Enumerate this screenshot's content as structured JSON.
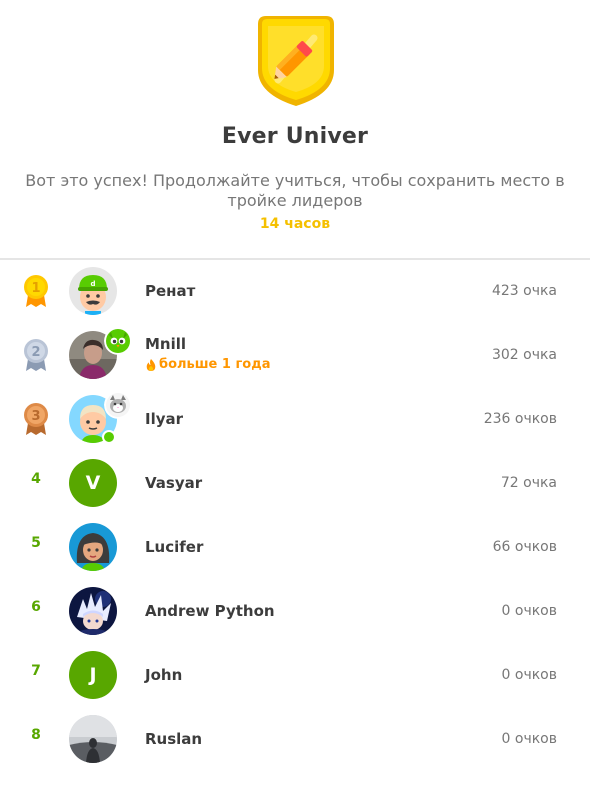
{
  "league": {
    "title": "Ever Univer",
    "subtitle": "Вот это успех! Продолжайте учиться, чтобы сохранить место в тройке лидеров",
    "time_left": "14 часов",
    "badge_icon": "pencil-shield-icon",
    "badge_color": "#ffc800"
  },
  "colors": {
    "rank_green": "#58a700",
    "gold": "#ffc800",
    "silver": "#b9c4d6",
    "bronze": "#de8a47",
    "streak_orange": "#ff9600"
  },
  "leaderboard": [
    {
      "rank": "1",
      "name": "Ренат",
      "points": "423 очка",
      "medal": "gold",
      "avatar": "cartoon-cap-avatar"
    },
    {
      "rank": "2",
      "name": "Mnill",
      "points": "302 очка",
      "medal": "silver",
      "avatar": "photo-avatar",
      "streak": "больше 1 года",
      "badge": "duo-owl-icon"
    },
    {
      "rank": "3",
      "name": "Ilyar",
      "points": "236 очков",
      "medal": "bronze",
      "avatar": "cartoon-boy-avatar",
      "badge": "cat-icon",
      "online": true
    },
    {
      "rank": "4",
      "name": "Vasyar",
      "points": "72 очка",
      "avatar_letter": "V"
    },
    {
      "rank": "5",
      "name": "Lucifer",
      "points": "66 очков",
      "avatar": "cartoon-girl-avatar"
    },
    {
      "rank": "6",
      "name": "Andrew Python",
      "points": "0 очков",
      "avatar": "anime-avatar"
    },
    {
      "rank": "7",
      "name": "John",
      "points": "0 очков",
      "avatar_letter": "J"
    },
    {
      "rank": "8",
      "name": "Ruslan",
      "points": "0 очков",
      "avatar": "foggy-photo-avatar"
    }
  ]
}
